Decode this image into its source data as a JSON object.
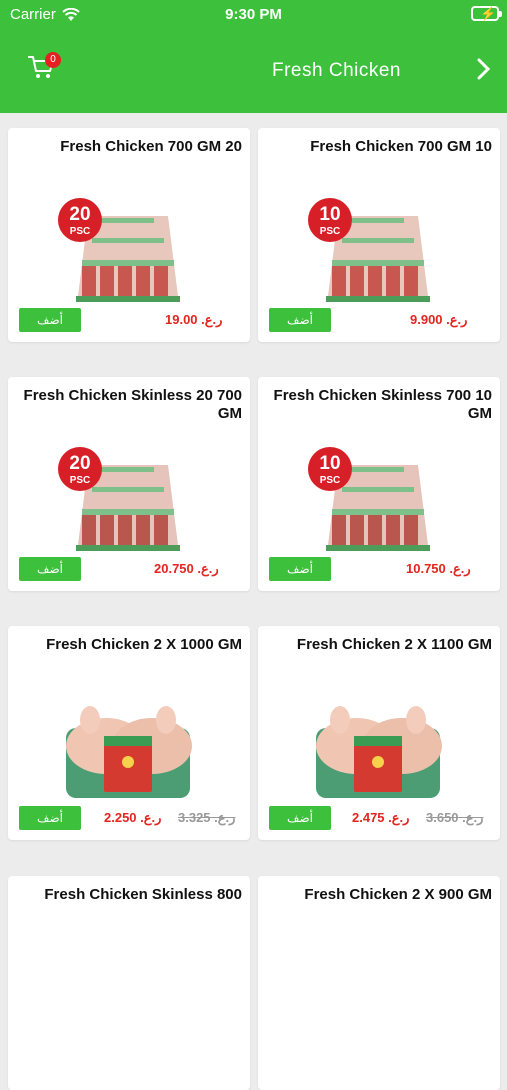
{
  "status": {
    "carrier": "Carrier",
    "time": "9:30 PM"
  },
  "header": {
    "title": "Fresh Chicken",
    "cart_count": "0"
  },
  "add_label": "أضف",
  "products": [
    {
      "name": "Fresh Chicken 700 GM 20",
      "price": "ر.ع. 19.00",
      "old": "",
      "count": "20",
      "type": "box"
    },
    {
      "name": "Fresh Chicken 700 GM 10",
      "price": "ر.ع. 9.900",
      "old": "",
      "count": "10",
      "type": "box"
    },
    {
      "name": "Fresh Chicken Skinless 20 700 GM",
      "price": "ر.ع. 20.750",
      "old": "",
      "count": "20",
      "type": "skinless"
    },
    {
      "name": "Fresh Chicken Skinless 700 10 GM",
      "price": "ر.ع. 10.750",
      "old": "",
      "count": "10",
      "type": "skinless"
    },
    {
      "name": "Fresh Chicken 2 X 1000 GM",
      "price": "ر.ع. 2.250",
      "old": "ر.ع. 3.325",
      "count": "",
      "type": "tray"
    },
    {
      "name": "Fresh Chicken 2 X 1100 GM",
      "price": "ر.ع. 2.475",
      "old": "ر.ع. 3.650",
      "count": "",
      "type": "tray"
    },
    {
      "name": "Fresh Chicken Skinless 800",
      "price": "",
      "old": "",
      "count": "",
      "type": "none"
    },
    {
      "name": "Fresh Chicken 2 X 900 GM",
      "price": "",
      "old": "",
      "count": "",
      "type": "none"
    }
  ]
}
